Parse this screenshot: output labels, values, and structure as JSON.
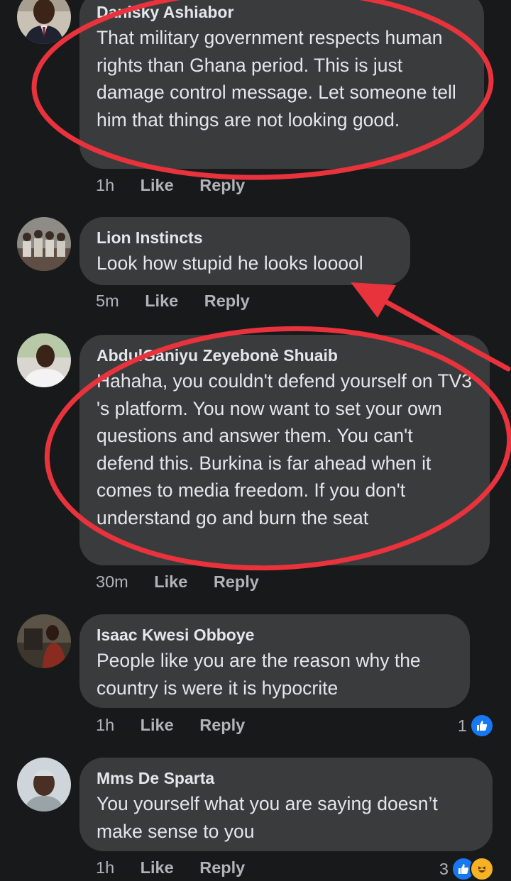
{
  "comments": [
    {
      "author": "Danisky Ashiabor",
      "text": "That military government respects human rights than Ghana period. This is just damage control message. Let someone tell him that things are not looking good.",
      "time": "1h",
      "like": "Like",
      "reply": "Reply",
      "avatar": "avatar-man-in-suit"
    },
    {
      "author": "Lion Instincts",
      "text": "Look how stupid he looks looool",
      "time": "5m",
      "like": "Like",
      "reply": "Reply",
      "avatar": "avatar-group-photo"
    },
    {
      "author": "AbdulGaniyu Zeyebonè Shuaib",
      "text": "Hahaha, you couldn't defend yourself on TV3 's platform. You now want to set your own questions and answer them. You can't defend this. Burkina is far ahead when it comes to media freedom. If you don't understand go and burn the seat",
      "time": "30m",
      "like": "Like",
      "reply": "Reply",
      "avatar": "avatar-man-outdoors"
    },
    {
      "author": "Isaac Kwesi Obboye",
      "text": "People like you are the reason why the country is were it is hypocrite",
      "time": "1h",
      "like": "Like",
      "reply": "Reply",
      "reaction_count": "1",
      "avatar": "avatar-man-with-machine"
    },
    {
      "author": "Mms De Sparta",
      "text": "You yourself what you are saying doesn’t make sense to you",
      "time": "1h",
      "like": "Like",
      "reply": "Reply",
      "reaction_count": "3",
      "avatar": "avatar-man-beanie"
    }
  ],
  "colors": {
    "background": "#18191a",
    "bubble": "#3a3b3c",
    "primary_text": "#e4e6eb",
    "secondary_text": "#b0b3b8",
    "annotation_red": "#e8333d",
    "like_blue": "#1877f2",
    "haha_yellow": "#f7b125"
  },
  "icons": [
    "like-reaction-icon",
    "haha-reaction-icon",
    "annotation-circle",
    "annotation-arrow"
  ]
}
